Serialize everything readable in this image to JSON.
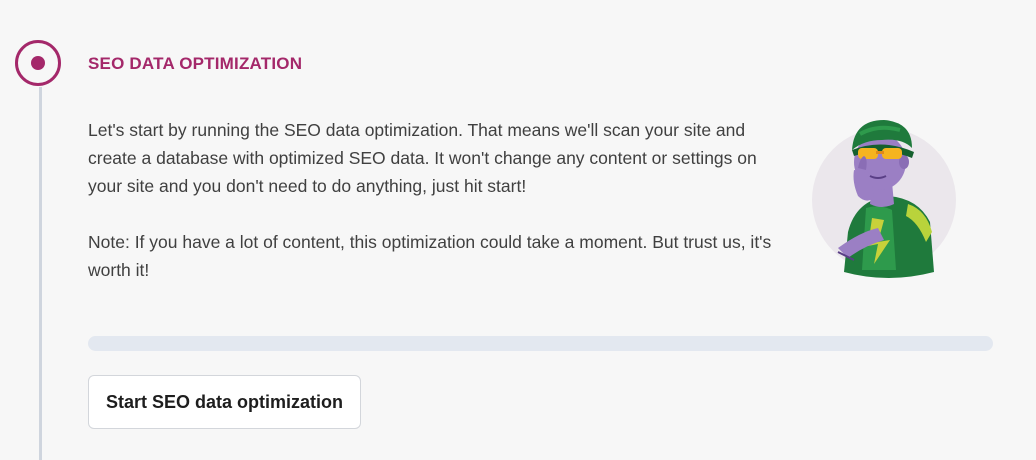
{
  "step": {
    "title": "SEO DATA OPTIMIZATION",
    "status": "active"
  },
  "description": {
    "paragraph1": "Let's start by running the SEO data optimization. That means we'll scan your site and create a database with optimized SEO data. It won't change any content or settings on your site and you don't need to do anything, just hit start!",
    "paragraph2": "Note: If you have a lot of content, this optimization could take a moment. But trust us, it's worth it!"
  },
  "progress": {
    "value": 0
  },
  "actions": {
    "start_label": "Start SEO data optimization"
  },
  "colors": {
    "accent": "#a4286a",
    "track": "#e3e8f0",
    "text": "#404040",
    "helmet": "#1f7a3c",
    "figure": "#9b7fc4"
  },
  "illustration": {
    "icon": "person-with-helmet-illustration"
  }
}
